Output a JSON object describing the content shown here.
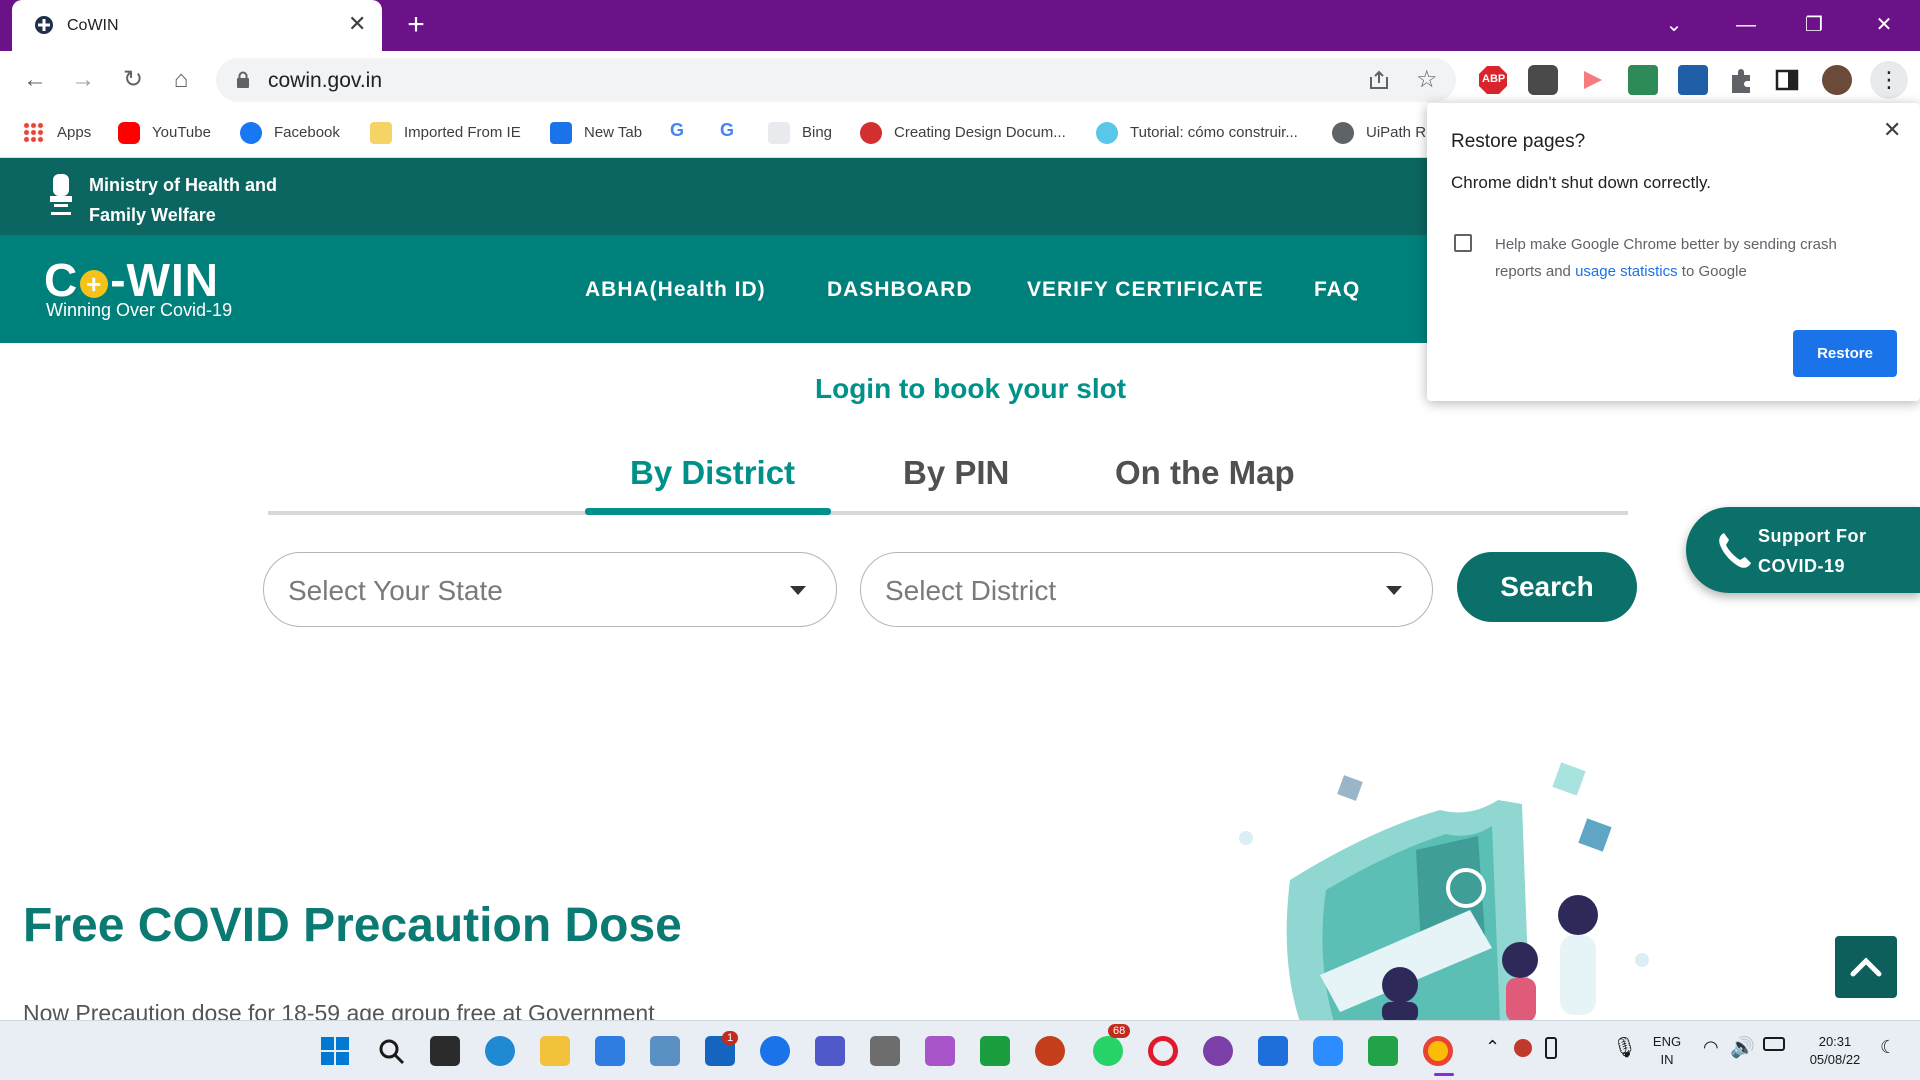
{
  "browser": {
    "tab_title": "CoWIN",
    "url": "cowin.gov.in",
    "bookmarks": [
      "Apps",
      "YouTube",
      "Facebook",
      "Imported From IE",
      "New Tab",
      "Bing",
      "Creating Design Docum...",
      "Tutorial: cómo construir...",
      "UiPath Rl"
    ],
    "extension_badge": "ABP"
  },
  "site": {
    "ministry": "Ministry of Health and Family Welfare",
    "logo_left": "C",
    "logo_right": "-WIN",
    "tagline": "Winning Over Covid-19",
    "nav": [
      "ABHA(Health ID)",
      "DASHBOARD",
      "VERIFY CERTIFICATE",
      "FAQ"
    ],
    "login_link": "Login to book your slot",
    "tabs": [
      "By District",
      "By PIN",
      "On the Map"
    ],
    "active_tab": "By District",
    "state_placeholder": "Select Your State",
    "district_placeholder": "Select District",
    "search_label": "Search",
    "support_line1": "Support For",
    "support_line2": "COVID-19",
    "headline": "Free COVID Precaution Dose",
    "subline": "Now Precaution dose for 18-59 age group free at Government"
  },
  "popup": {
    "title": "Restore pages?",
    "message": "Chrome didn't shut down correctly.",
    "crash_text_1": "Help make Google Chrome better by sending crash reports and",
    "crash_link": "usage statistics",
    "crash_text_2": "to Google",
    "restore_button": "Restore"
  },
  "taskbar": {
    "whatsapp_badge": "68",
    "mail_badge": "1",
    "language_1": "ENG",
    "language_2": "IN",
    "time": "20:31",
    "date": "05/08/22"
  },
  "colors": {
    "tabstrip": "#6c1289",
    "ministry_bar": "#0b6560",
    "nav_bar": "#00807b",
    "accent": "#00908a",
    "chrome_blue": "#1a73e8"
  }
}
